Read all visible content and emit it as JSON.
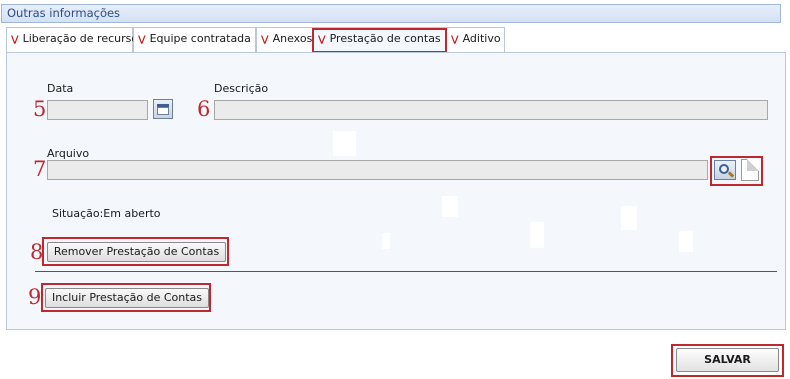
{
  "section": {
    "title": "Outras informações"
  },
  "tabs": [
    {
      "label": "Liberação de recurso"
    },
    {
      "label": "Equipe contratada"
    },
    {
      "label": "Anexos"
    },
    {
      "label": "Prestação de contas"
    },
    {
      "label": "Aditivo"
    }
  ],
  "active_tab": "Prestação de contas",
  "form": {
    "data_label": "Data",
    "data_value": "",
    "descricao_label": "Descrição",
    "descricao_value": "",
    "arquivo_label": "Arquivo",
    "arquivo_value": "",
    "situacao_text": "Situação:Em aberto"
  },
  "buttons": {
    "remover": "Remover Prestação de Contas",
    "incluir": "Incluir Prestação de Contas",
    "salvar": "SALVAR"
  },
  "annotations": [
    "5",
    "6",
    "7",
    "8",
    "9"
  ],
  "icons": {
    "chevron": "double-chevron-down-icon",
    "calendar": "calendar-icon",
    "search": "magnifier-icon",
    "document": "document-icon"
  },
  "colors": {
    "header_bg": "#d4e1f4",
    "header_text": "#2b4e86",
    "panel_bg": "#f4f8fd",
    "annotation": "#c0282d",
    "tab_chevron": "#c21a1a"
  }
}
